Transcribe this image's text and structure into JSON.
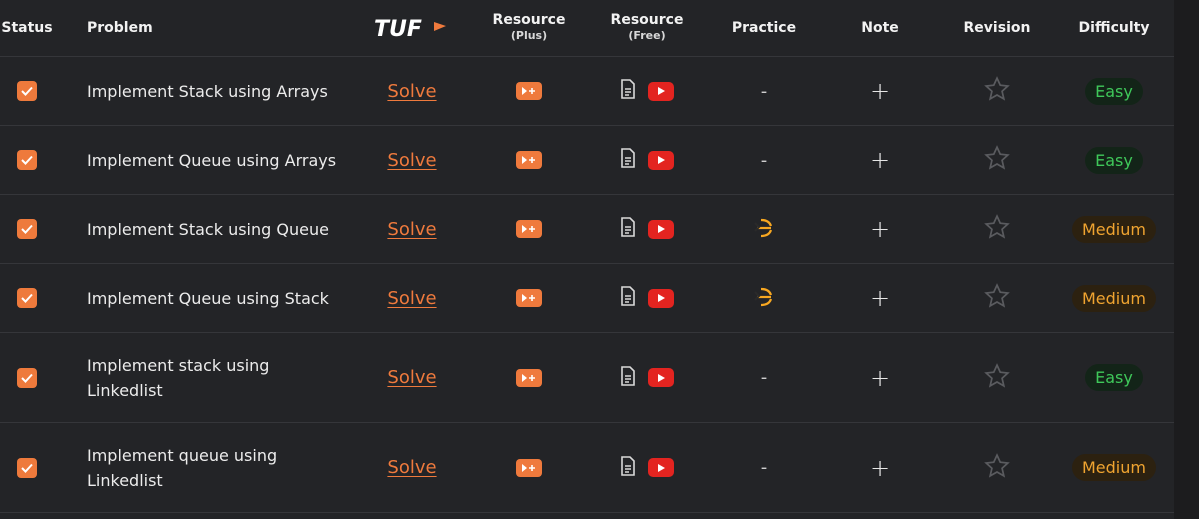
{
  "header": {
    "status": "Status",
    "problem": "Problem",
    "resource_plus": "Resource",
    "resource_plus_sub": "(Plus)",
    "resource_free": "Resource",
    "resource_free_sub": "(Free)",
    "practice": "Practice",
    "note": "Note",
    "revision": "Revision",
    "difficulty": "Difficulty",
    "tuf_logo_text": "TUF"
  },
  "rows": [
    {
      "problem_line1": "Implement Stack using Arrays",
      "problem_line2": "",
      "solve": "Solve",
      "practice": "-",
      "note": "+",
      "difficulty": "Easy",
      "difficulty_color": "#3fc85a",
      "checked": true
    },
    {
      "problem_line1": "Implement Queue using Arrays",
      "problem_line2": "",
      "solve": "Solve",
      "practice": "-",
      "note": "+",
      "difficulty": "Easy",
      "difficulty_color": "#3fc85a",
      "checked": true
    },
    {
      "problem_line1": "Implement Stack using Queue",
      "problem_line2": "",
      "solve": "Solve",
      "practice": "codestudio-icon",
      "note": "+",
      "difficulty": "Medium",
      "difficulty_color": "#f0a430",
      "checked": true
    },
    {
      "problem_line1": "Implement Queue using Stack",
      "problem_line2": "",
      "solve": "Solve",
      "practice": "codestudio-icon",
      "note": "+",
      "difficulty": "Medium",
      "difficulty_color": "#f0a430",
      "checked": true
    },
    {
      "problem_line1": "Implement stack using",
      "problem_line2": "Linkedlist",
      "solve": "Solve",
      "practice": "-",
      "note": "+",
      "difficulty": "Easy",
      "difficulty_color": "#3fc85a",
      "checked": true
    },
    {
      "problem_line1": "Implement queue using",
      "problem_line2": "Linkedlist",
      "solve": "Solve",
      "practice": "-",
      "note": "+",
      "difficulty": "Medium",
      "difficulty_color": "#f0a430",
      "checked": true
    }
  ],
  "colors": {
    "accent": "#ef7a3d",
    "youtube": "#e32420",
    "easy": "#3fc85a",
    "medium": "#f0a430",
    "background": "#232427"
  }
}
